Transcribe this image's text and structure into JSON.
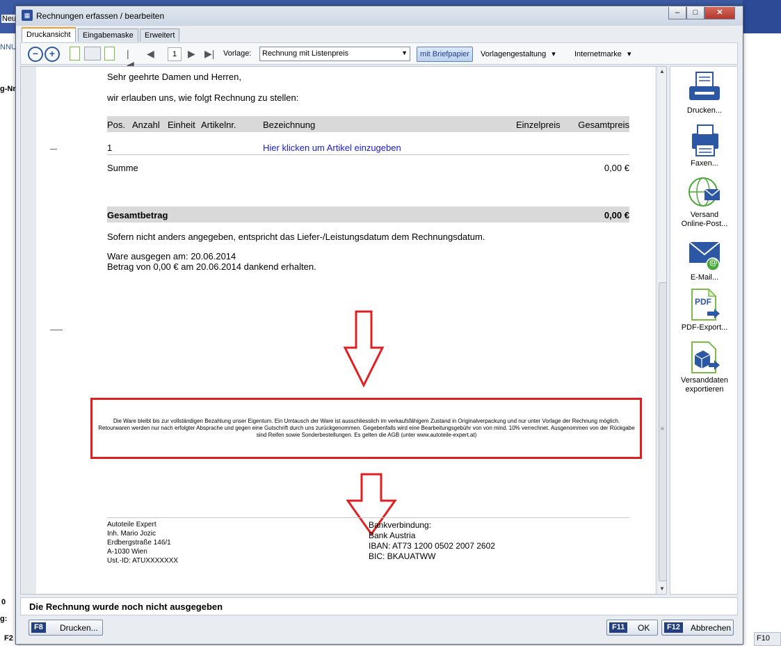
{
  "background": {
    "left_labels": [
      "Neu",
      "NNU",
      "g-Nr",
      "0",
      "g:",
      "F2"
    ],
    "right_fkey": "F10"
  },
  "window": {
    "title": "Rechnungen erfassen / bearbeiten",
    "minimize": "–",
    "maximize": "□",
    "close": "✕"
  },
  "tabs": [
    {
      "label": "Druckansicht",
      "active": true
    },
    {
      "label": "Eingabemaske",
      "active": false
    },
    {
      "label": "Erweitert",
      "active": false
    }
  ],
  "toolbar": {
    "zoom_out": "−",
    "zoom_in": "+",
    "first": "|◀",
    "prev": "◀",
    "page": "1",
    "next": "▶",
    "last": "▶|",
    "vorlage_label": "Vorlage:",
    "vorlage_value": "Rechnung mit Listenpreis",
    "briefpapier": "mit Briefpapier",
    "vorlagengestaltung": "Vorlagengestaltung",
    "internetmarke": "Internetmarke",
    "dropdown_glyph": "▾"
  },
  "document": {
    "salutation": "Sehr geehrte Damen und Herren,",
    "intro": "wir erlauben uns, wie folgt Rechnung zu stellen:",
    "columns": [
      "Pos.",
      "Anzahl",
      "Einheit",
      "Artikelnr.",
      "Bezeichnung",
      "Einzelpreis",
      "Gesamtpreis"
    ],
    "row": {
      "pos": "1",
      "hint": "Hier klicken um Artikel einzugeben"
    },
    "summe_label": "Summe",
    "summe_value": "0,00 €",
    "gesamt_label": "Gesamtbetrag",
    "gesamt_value": "0,00 €",
    "note": "Sofern nicht anders angegeben, entspricht das Liefer-/Leistungsdatum dem Rechnungsdatum.",
    "ware_line": "Ware ausgegen am: 20.06.2014",
    "betrag_line": "Betrag von 0,00 € am 20.06.2014 dankend erhalten.",
    "terms": "Die Ware bleibt bis zur vollständigen Bezahlung unser Eigentum. Ein Umtausch der Ware ist ausschliesslich im verkaufsfähigem Zustand in Originalverpackung und nur unter Vorlage der Rechnung möglich. Retourwaren werden nur nach erfolgter Absprache und gegen eine Gutschrift durch uns zurückgenommen. Gegebenfalls wird eine Bearbeitungsgebühr von von mind. 10% verrechnet. Ausgenommen von der Rückgabe sind Reifen sowie Sonderbestellungen. Es gelten die AGB (unter www.autoteile-expert.at)",
    "footer_address": [
      "Autoteile Expert",
      "Inh. Mario Jozic",
      "Erdbergstraße 146/1",
      "A-1030 Wien",
      "Ust.-ID: ATUXXXXXXX"
    ],
    "footer_bank": [
      "Bankverbindung:",
      "Bank Austria",
      "IBAN: AT73 1200 0502 2007 2602",
      "BIC: BKAUATWW"
    ]
  },
  "side_actions": [
    {
      "label1": "Drucken...",
      "label2": ""
    },
    {
      "label1": "Faxen...",
      "label2": ""
    },
    {
      "label1": "Versand",
      "label2": "Online-Post..."
    },
    {
      "label1": "E-Mail...",
      "label2": ""
    },
    {
      "label1": "PDF-Export...",
      "label2": ""
    },
    {
      "label1": "Versanddaten",
      "label2": "exportieren"
    }
  ],
  "side_icon_text": {
    "pdf": "PDF",
    "at": "@"
  },
  "status": "Die Rechnung wurde noch nicht ausgegeben",
  "buttons": {
    "print_key": "F8",
    "print_label": "Drucken...",
    "ok_key": "F11",
    "ok_label": "OK",
    "cancel_key": "F12",
    "cancel_label": "Abbrechen"
  },
  "colors": {
    "accent": "#2b57a4",
    "highlight": "#e02020",
    "link": "#1a1ad8"
  }
}
